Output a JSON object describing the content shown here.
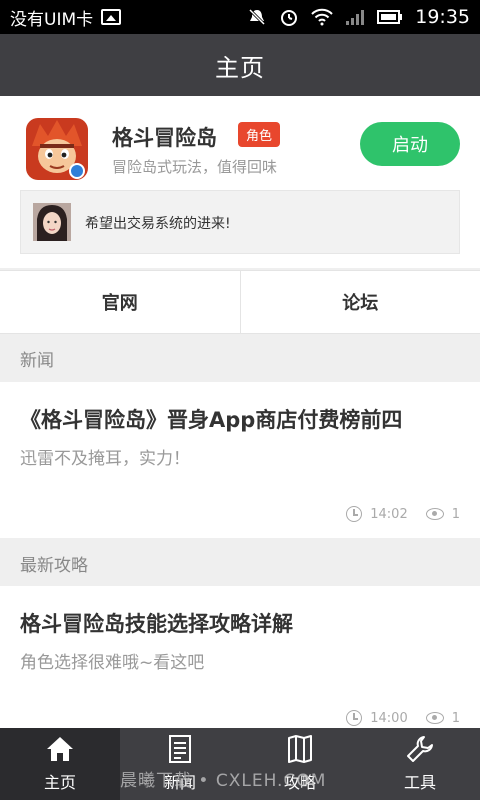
{
  "status_bar": {
    "carrier": "没有UIM卡",
    "time": "19:35",
    "icons": [
      "image-icon",
      "mute-icon",
      "alarm-icon",
      "wifi-icon",
      "signal-icon",
      "battery-icon"
    ]
  },
  "header": {
    "title": "主页"
  },
  "game": {
    "name": "格斗冒险岛",
    "tag": "角色",
    "description": "冒险岛式玩法，值得回味",
    "launch_label": "启动",
    "comment": "希望出交易系统的进来!"
  },
  "links": [
    {
      "label": "官网"
    },
    {
      "label": "论坛"
    }
  ],
  "sections": {
    "news": {
      "heading": "新闻",
      "article": {
        "title": "《格斗冒险岛》晋身App商店付费榜前四",
        "subtitle": "迅雷不及掩耳，实力！",
        "time": "14:02",
        "views": "1"
      }
    },
    "guides": {
      "heading": "最新攻略",
      "article": {
        "title": "格斗冒险岛技能选择攻略详解",
        "subtitle": "角色选择很难哦~看这吧",
        "time": "14:00",
        "views": "1"
      }
    }
  },
  "bottom_nav": {
    "items": [
      {
        "label": "主页",
        "icon": "home-icon",
        "active": true
      },
      {
        "label": "新闻",
        "icon": "document-icon",
        "active": false
      },
      {
        "label": "攻略",
        "icon": "book-icon",
        "active": false
      },
      {
        "label": "工具",
        "icon": "wrench-icon",
        "active": false
      }
    ]
  },
  "watermark": "晨曦下载 • CXLEH.COM",
  "colors": {
    "titlebar": "#3f3f43",
    "launch_button": "#2fc36b",
    "tag": "#e8472d"
  }
}
